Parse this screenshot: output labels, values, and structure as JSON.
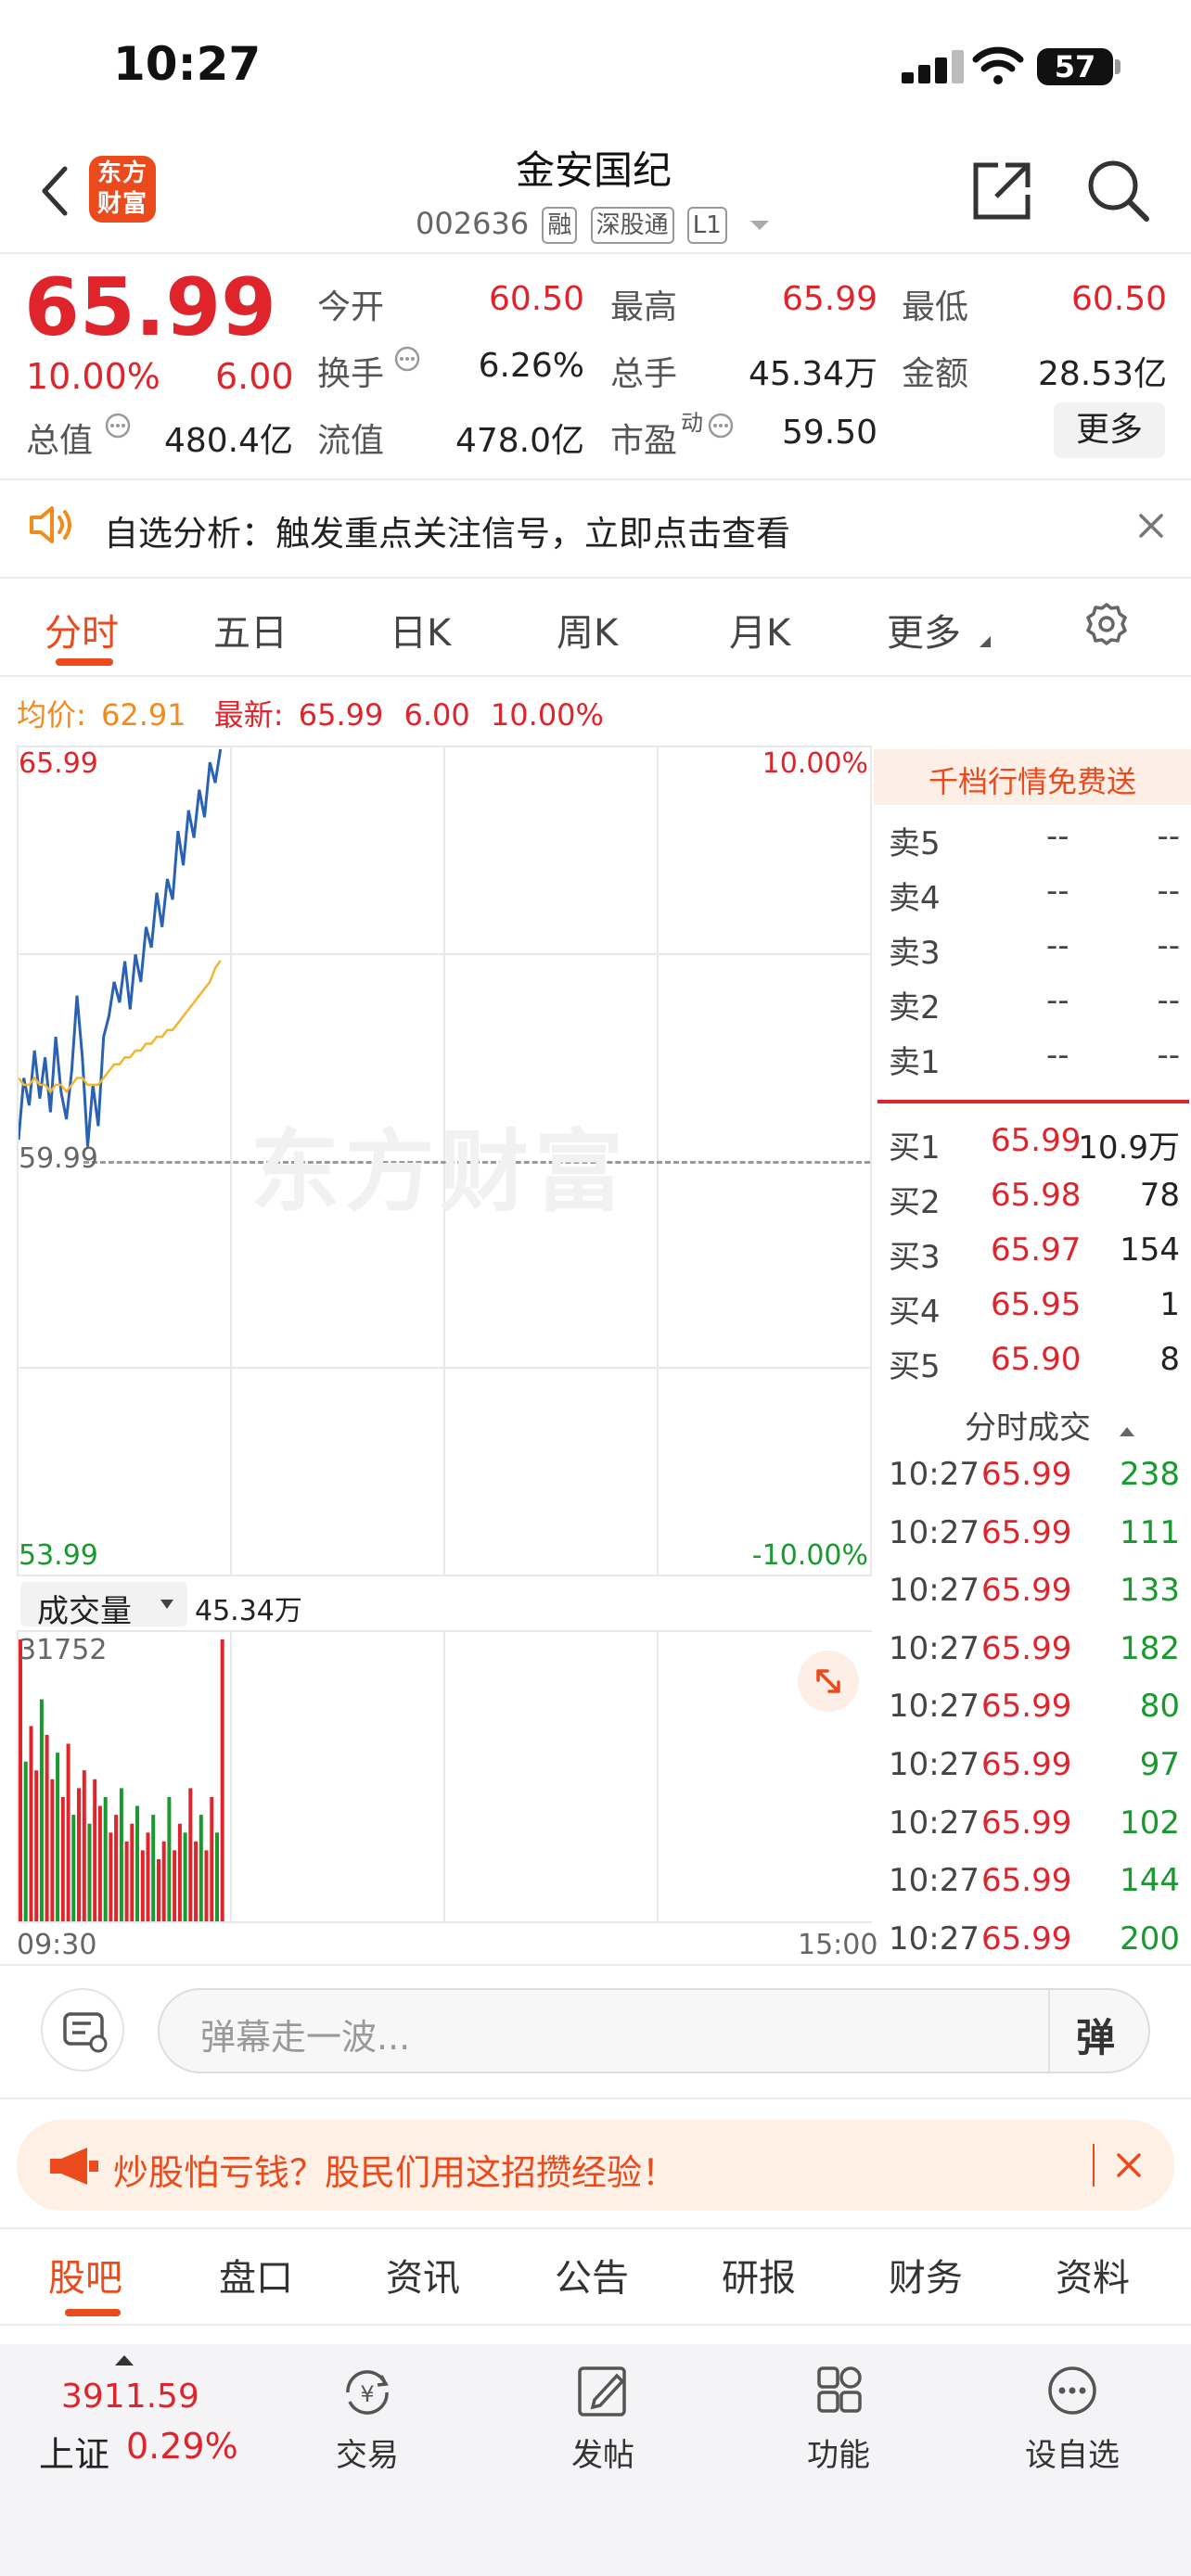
{
  "status": {
    "time": "10:27",
    "battery": "57"
  },
  "header": {
    "logo_text": "东方财富",
    "stock_name": "金安国纪",
    "stock_code": "002636",
    "tags": [
      "融",
      "深股通",
      "L1"
    ]
  },
  "quote": {
    "price": "65.99",
    "change_pct": "10.00%",
    "change_amt": "6.00",
    "fields": [
      {
        "label": "今开",
        "value": "60.50"
      },
      {
        "label": "最高",
        "value": "65.99"
      },
      {
        "label": "最低",
        "value": "60.50"
      },
      {
        "label": "换手",
        "value": "6.26%"
      },
      {
        "label": "总手",
        "value": "45.34万"
      },
      {
        "label": "金额",
        "value": "28.53亿"
      },
      {
        "label": "总值",
        "value": "480.4亿"
      },
      {
        "label": "流值",
        "value": "478.0亿"
      },
      {
        "label": "市盈",
        "value": "59.50"
      }
    ],
    "pe_sup": "动",
    "more_label": "更多"
  },
  "notice": {
    "text": "自选分析：触发重点关注信号，立即点击查看"
  },
  "chart_tabs": [
    "分时",
    "五日",
    "日K",
    "周K",
    "月K",
    "更多"
  ],
  "chart_info": {
    "avg_label": "均价:",
    "avg_value": "62.91",
    "latest_label": "最新:",
    "latest_value": "65.99",
    "latest_change": "6.00",
    "latest_pct": "10.00%"
  },
  "chart_axes": {
    "top_price": "65.99",
    "top_pct": "10.00%",
    "mid_price": "59.99",
    "bottom_price": "53.99",
    "bottom_pct": "-10.00%",
    "watermark": "东方财富",
    "volume_selector": "成交量",
    "volume_total": "45.34万",
    "volume_max": "31752",
    "time_start": "09:30",
    "time_end": "15:00"
  },
  "chart_data": {
    "type": "line",
    "ylim": [
      53.99,
      65.99
    ],
    "series": [
      {
        "name": "最新",
        "color": "#2a62b3",
        "values": [
          60.3,
          61.2,
          60.8,
          61.6,
          60.9,
          61.5,
          60.7,
          61.8,
          61.0,
          60.6,
          61.3,
          62.4,
          61.5,
          60.2,
          61.1,
          60.5,
          61.8,
          62.1,
          62.6,
          62.3,
          62.9,
          62.2,
          63.0,
          62.6,
          63.4,
          63.1,
          63.9,
          63.4,
          64.1,
          63.8,
          64.8,
          64.3,
          65.1,
          64.7,
          65.4,
          65.0,
          65.8,
          65.5,
          65.99
        ]
      },
      {
        "name": "均价",
        "color": "#f2b632",
        "values": [
          61.2,
          61.1,
          61.1,
          61.2,
          61.1,
          61.1,
          61.0,
          61.1,
          61.1,
          61.0,
          61.1,
          61.2,
          61.2,
          61.1,
          61.1,
          61.1,
          61.2,
          61.3,
          61.4,
          61.4,
          61.5,
          61.5,
          61.6,
          61.6,
          61.7,
          61.7,
          61.8,
          61.8,
          61.9,
          61.9,
          62.0,
          62.1,
          62.2,
          62.3,
          62.4,
          62.5,
          62.6,
          62.8,
          62.91
        ]
      }
    ],
    "volume": [
      31752,
      18000,
      22000,
      17000,
      25000,
      21000,
      16000,
      19000,
      14000,
      20000,
      12000,
      15000,
      17000,
      11000,
      16000,
      13000,
      14000,
      10000,
      12000,
      15000,
      9000,
      11000,
      13000,
      8000,
      10000,
      12000,
      7000,
      9000,
      14000,
      8000,
      11000,
      10000,
      15000,
      9000,
      12000,
      8000,
      14000,
      10000,
      31752
    ]
  },
  "order_book": {
    "banner": "千档行情免费送",
    "asks": [
      {
        "label": "卖5",
        "price": "--",
        "vol": "--"
      },
      {
        "label": "卖4",
        "price": "--",
        "vol": "--"
      },
      {
        "label": "卖3",
        "price": "--",
        "vol": "--"
      },
      {
        "label": "卖2",
        "price": "--",
        "vol": "--"
      },
      {
        "label": "卖1",
        "price": "--",
        "vol": "--"
      }
    ],
    "bids": [
      {
        "label": "买1",
        "price": "65.99",
        "vol": "10.9万"
      },
      {
        "label": "买2",
        "price": "65.98",
        "vol": "78"
      },
      {
        "label": "买3",
        "price": "65.97",
        "vol": "154"
      },
      {
        "label": "买4",
        "price": "65.95",
        "vol": "1"
      },
      {
        "label": "买5",
        "price": "65.90",
        "vol": "8"
      }
    ],
    "trades_header": "分时成交",
    "trades": [
      {
        "time": "10:27",
        "price": "65.99",
        "vol": "238"
      },
      {
        "time": "10:27",
        "price": "65.99",
        "vol": "111"
      },
      {
        "time": "10:27",
        "price": "65.99",
        "vol": "133"
      },
      {
        "time": "10:27",
        "price": "65.99",
        "vol": "182"
      },
      {
        "time": "10:27",
        "price": "65.99",
        "vol": "80"
      },
      {
        "time": "10:27",
        "price": "65.99",
        "vol": "97"
      },
      {
        "time": "10:27",
        "price": "65.99",
        "vol": "102"
      },
      {
        "time": "10:27",
        "price": "65.99",
        "vol": "144"
      },
      {
        "time": "10:27",
        "price": "65.99",
        "vol": "200"
      }
    ]
  },
  "comment": {
    "placeholder": "弹幕走一波...",
    "danmu_icon": "弹"
  },
  "ad": {
    "text": "炒股怕亏钱？股民们用这招攒经验！"
  },
  "section_tabs": [
    "股吧",
    "盘口",
    "资讯",
    "公告",
    "研报",
    "财务",
    "资料"
  ],
  "bottom_bar": {
    "index_value": "3911.59",
    "index_name": "上证",
    "index_pct": "0.29%",
    "items": [
      {
        "label": "交易",
        "icon": "yuan-refresh-icon"
      },
      {
        "label": "发帖",
        "icon": "edit-icon"
      },
      {
        "label": "功能",
        "icon": "grid-icon"
      },
      {
        "label": "设自选",
        "icon": "more-dots-icon"
      }
    ]
  },
  "colors": {
    "up": "#e0242b",
    "down": "#1a9a2e",
    "accent": "#ea4a1c",
    "avg_line": "#f2b632",
    "price_line": "#2a62b3"
  }
}
